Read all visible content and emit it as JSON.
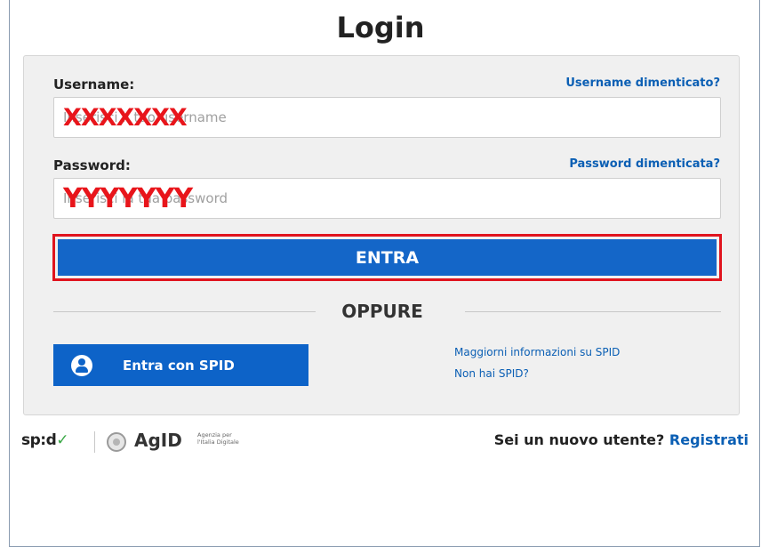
{
  "title": "Login",
  "form": {
    "username_label": "Username:",
    "username_forgot": "Username dimenticato?",
    "username_placeholder": "Inserisci il tuo username",
    "username_value": "XXXXXXX",
    "password_label": "Password:",
    "password_forgot": "Password dimenticata?",
    "password_placeholder": "Inserisci la tua password",
    "password_value": "YYYYYYY",
    "submit_label": "ENTRA",
    "divider_label": "OPPURE"
  },
  "spid": {
    "button_label": "Entra con SPID",
    "icon": "user-icon",
    "info_link": "Maggiorni informazioni su SPID",
    "no_spid_link": "Non hai SPID?"
  },
  "footer": {
    "spid_logo": "sp:d",
    "agid_logo": "AgID",
    "agid_subtitle": "Agenzia per l'Italia Digitale",
    "new_user_text": "Sei un nuovo utente?",
    "register_link": "Registrati"
  },
  "colors": {
    "primary_blue": "#1466c8",
    "link_blue": "#0b5fb4",
    "highlight_red": "#e0141e",
    "panel_bg": "#f0f0f0"
  }
}
